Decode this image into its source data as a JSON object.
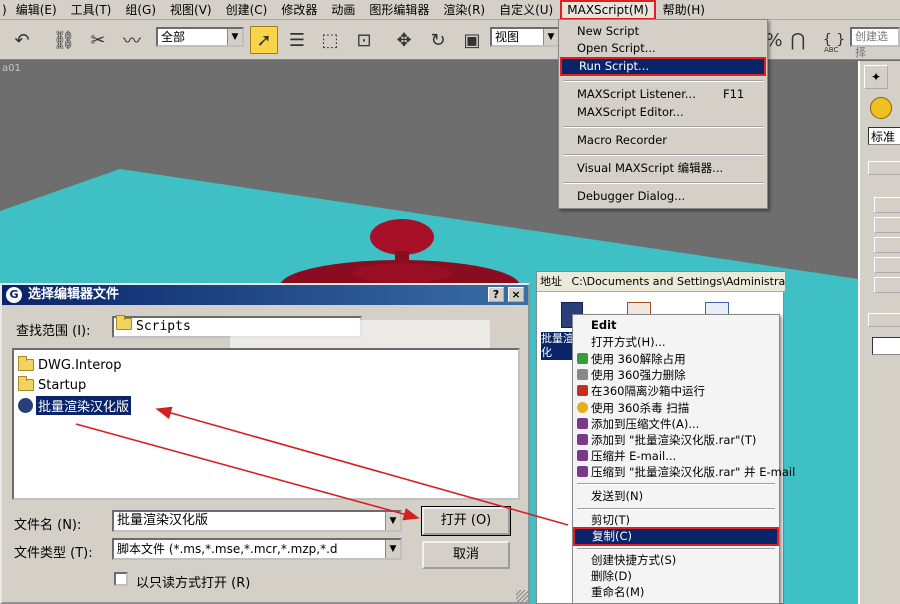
{
  "menubar": {
    "items": [
      ")",
      "编辑(E)",
      "工具(T)",
      "组(G)",
      "视图(V)",
      "创建(C)",
      "修改器",
      "动画",
      "图形编辑器",
      "渲染(R)",
      "自定义(U)",
      "MAXScript(M)",
      "帮助(H)"
    ]
  },
  "toolbar": {
    "selection_filter": "全部",
    "view_combo": "视图",
    "named_sel_placeholder": "创建选择",
    "abc_label": "ABC"
  },
  "viewport": {
    "label": "a01"
  },
  "maxscript_menu": {
    "items": [
      "New Script",
      "Open Script...",
      "Run Script...",
      "MAXScript Listener...",
      "MAXScript Editor...",
      "Macro Recorder",
      "Visual MAXScript 编辑器...",
      "Debugger Dialog..."
    ],
    "listener_shortcut": "F11",
    "selected": "Run Script..."
  },
  "dialog": {
    "title": "选择编辑器文件",
    "lookin_label": "查找范围 (I):",
    "lookin_value": "Scripts",
    "files": [
      "DWG.Interop",
      "Startup",
      "批量渲染汉化版"
    ],
    "filename_label": "文件名 (N):",
    "filename_value": "批量渲染汉化版",
    "filetype_label": "文件类型 (T):",
    "filetype_value": "脚本文件  (*.ms,*.mse,*.mcr,*.mzp,*.d",
    "readonly_label": "以只读方式打开 (R)",
    "open_button": "打开 (O)",
    "cancel_button": "取消",
    "help_button": "?",
    "close_button": "×"
  },
  "explorer": {
    "address_label": "地址",
    "path": "C:\\Documents and Settings\\Administrat",
    "file_label": "批量渲\n化"
  },
  "context_menu": {
    "items": [
      "Edit",
      "打开方式(H)...",
      "使用 360解除占用",
      "使用 360强力删除",
      "在360隔离沙箱中运行",
      "使用 360杀毒 扫描",
      "添加到压缩文件(A)...",
      "添加到 \"批量渲染汉化版.rar\"(T)",
      "压缩并 E-mail...",
      "压缩到 \"批量渲染汉化版.rar\" 并 E-mail",
      "发送到(N)",
      "剪切(T)",
      "复制(C)",
      "创建快捷方式(S)",
      "删除(D)",
      "重命名(M)"
    ],
    "selected": "复制(C)"
  },
  "cmdpanel": {
    "std_label": "标准"
  },
  "colors": {
    "titlebar": "#0a246a",
    "menu_selected": "#0a246a",
    "highlight_box": "#e02020",
    "teapot": "#b0102a",
    "ground": "#3ec0c4",
    "arrow": "#d42020"
  }
}
